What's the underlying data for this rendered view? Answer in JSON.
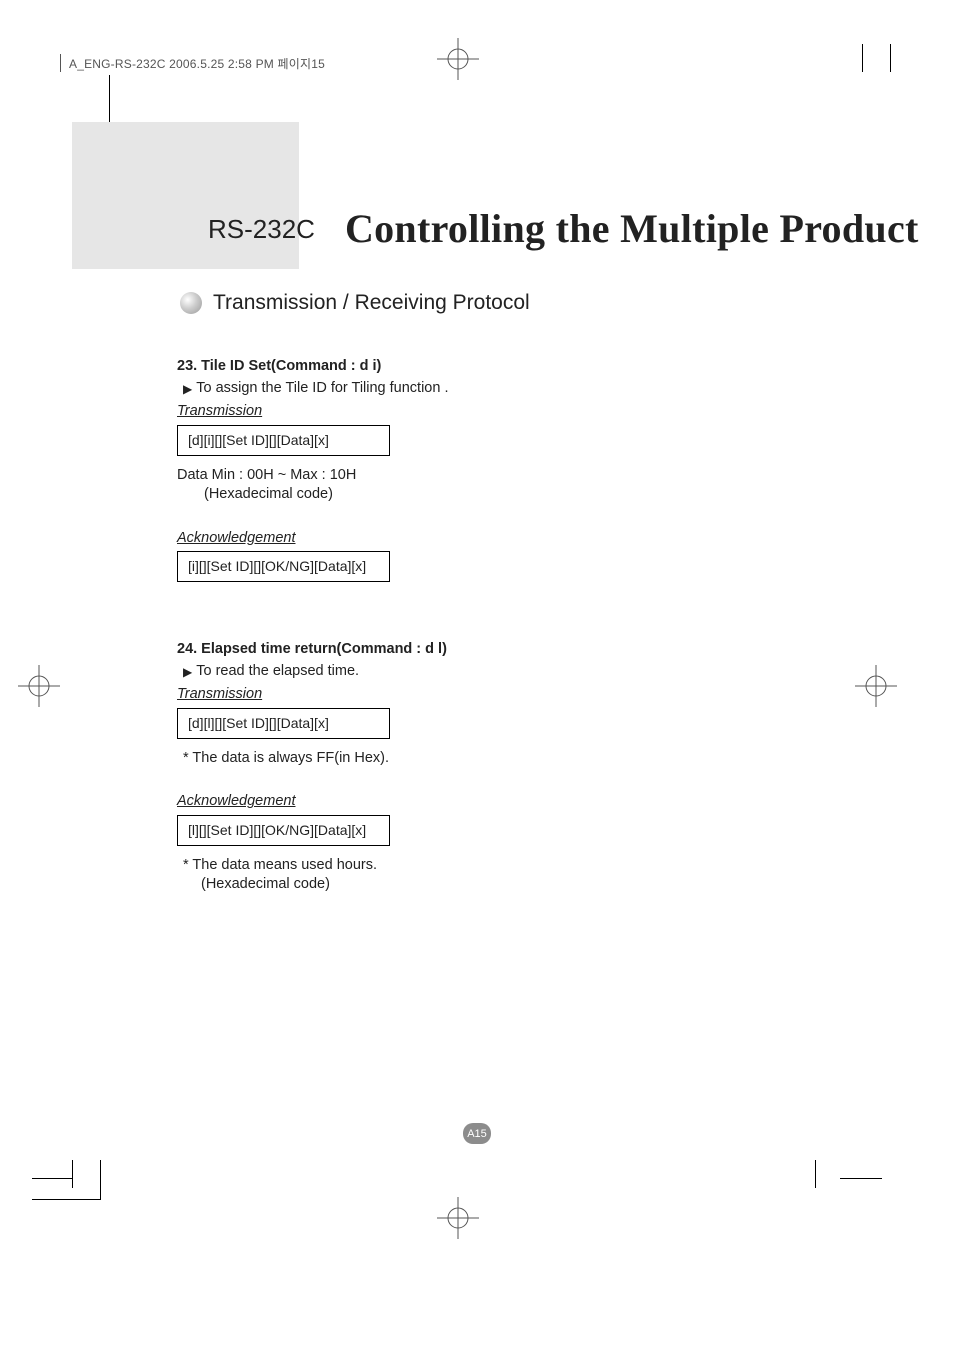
{
  "meta": {
    "slug": "A_ENG-RS-232C  2006.5.25  2:58 PM  페이지15"
  },
  "title": {
    "prefix": "RS-232C",
    "main": "Controlling the Multiple Product"
  },
  "subtitle": "Transmission / Receiving Protocol",
  "sections": [
    {
      "heading": "23. Tile ID Set(Command : d i)",
      "desc": "To assign the Tile ID for Tiling function .",
      "trans_label": "Transmission",
      "trans_box": "[d][i][][Set ID][][Data][x]",
      "data_line": "Data      Min : 00H ~ Max : 10H",
      "data_note": "(Hexadecimal code)",
      "ack_label": "Acknowledgement",
      "ack_box": "[i][][Set ID][][OK/NG][Data][x]"
    },
    {
      "heading": "24. Elapsed time return(Command : d l)",
      "desc": "To read the elapsed time.",
      "trans_label": "Transmission",
      "trans_box": "[d][l][][Set ID][][Data][x]",
      "note1": "* The data is always FF(in Hex).",
      "ack_label": "Acknowledgement",
      "ack_box": "[l][][Set ID][][OK/NG][Data][x]",
      "note2a": "* The data means used hours.",
      "note2b": "(Hexadecimal code)"
    }
  ],
  "page_label": "A15"
}
